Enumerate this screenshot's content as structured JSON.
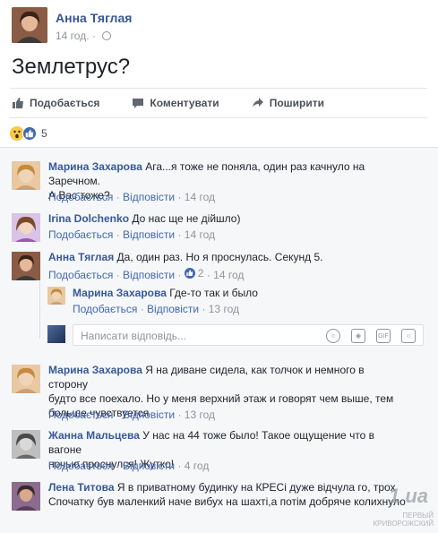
{
  "post": {
    "author": "Анна Тяглая",
    "time": "14 год.",
    "text": "Землетрус?"
  },
  "actions": {
    "like": "Подобається",
    "comment": "Коментувати",
    "share": "Поширити"
  },
  "reactions": {
    "count": "5"
  },
  "comment_actions": {
    "like": "Подобається",
    "reply": "Відповісти"
  },
  "comments": [
    {
      "name": "Марина Захарова",
      "text1": "Ага...я тоже не поняла, один раз качнуло на Заречном.",
      "text2": "А Вас тоже?",
      "time": "14 год"
    },
    {
      "name": "Irina Dolchenko",
      "text1": "До нас ще не дійшло)",
      "time": "14 год"
    },
    {
      "name": "Анна Тяглая",
      "text1": "Да, один раз. Но я проснулась. Секунд 5.",
      "reply_count": "2",
      "time": "14 год"
    },
    {
      "name": "Марина Захарова",
      "text1": "Я на диване сидела, как толчок и немного в сторону",
      "text2": "будто все поехало. Но у меня верхний этаж и говорят чем выше, тем",
      "text3": "больше чувствуется",
      "time": "13 год"
    },
    {
      "name": "Жанна Мальцева",
      "text1": "У нас на 44 тоже было! Такое ощущение что в вагоне",
      "text2": "ночью проснулся! Жутко!",
      "time": "4 год"
    },
    {
      "name": "Лена Титова",
      "text1": "Я в приватному будинку на КРЕСі дуже відчула го, трох",
      "text2": "Спочатку був маленкий наче вибух на шахті,а потім добряче колихнуло"
    }
  ],
  "reply": {
    "name": "Марина Захарова",
    "text1": "Где-то так и было",
    "time": "13 год"
  },
  "reply_input": {
    "placeholder": "Написати відповідь..."
  },
  "watermark": {
    "brand": "1 ua",
    "sub1": "ПЕРВЫЙ",
    "sub2": "КРИВОРОЖСКИЙ"
  }
}
